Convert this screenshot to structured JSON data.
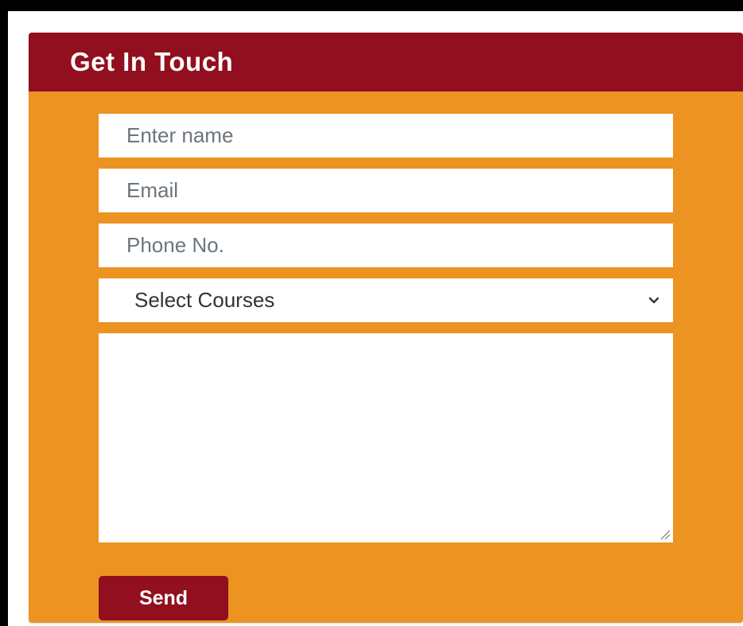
{
  "form": {
    "title": "Get In Touch",
    "name_placeholder": "Enter name",
    "email_placeholder": "Email",
    "phone_placeholder": "Phone No.",
    "course_select_value": "Select Courses",
    "message_value": "",
    "send_label": "Send"
  },
  "icons": {
    "select_arrow": "chevron-down-icon",
    "textarea_resize": "resize-grip-icon"
  },
  "colors": {
    "header_background": "#910f1e",
    "card_background": "#ec9322",
    "button_background": "#910f1e",
    "field_background": "#ffffff",
    "title_text": "#ffffff"
  }
}
